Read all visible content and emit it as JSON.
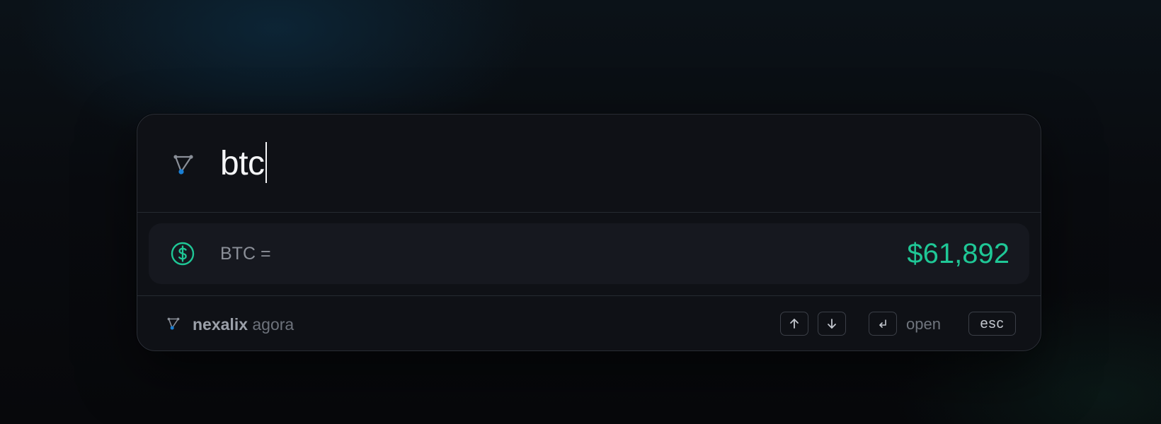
{
  "search": {
    "query": "btc"
  },
  "result": {
    "label": "BTC =",
    "value": "$61,892"
  },
  "footer": {
    "brand_name": "nexalix",
    "brand_sub": "agora",
    "open_label": "open",
    "esc_label": "esc"
  },
  "icons": {
    "logo": "nexalix-logo-icon",
    "result": "dollar-circle-icon",
    "up": "arrow-up-icon",
    "down": "arrow-down-icon",
    "enter": "enter-return-icon"
  },
  "colors": {
    "accent": "#1fc796",
    "logo_dot": "#1a7fd4",
    "panel": "#0f1116",
    "result_bg": "#16181f"
  }
}
